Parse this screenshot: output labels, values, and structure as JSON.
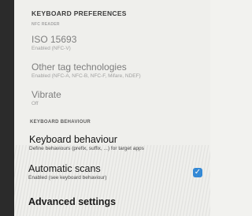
{
  "settings": {
    "keyboard_preferences_header": "KEYBOARD PREFERENCES",
    "nfc_reader_header": "NFC READER",
    "items": [
      {
        "title": "ISO 15693",
        "subtitle": "Enabled (NFC-V)"
      },
      {
        "title": "Other tag technologies",
        "subtitle": "Enabled (NFC-A, NFC-B, NFC-F, Mifare, NDEF)"
      },
      {
        "title": "Vibrate",
        "subtitle": "Off"
      }
    ],
    "keyboard_behaviour_header": "KEYBOARD BEHAVIOUR",
    "keyboard_behaviour": {
      "title": "Keyboard behaviour",
      "subtitle": "Define behaviours (prefix, suffix, ...) for target apps"
    },
    "automatic_scans": {
      "title": "Automatic scans",
      "subtitle": "Enabled (see keyboard behaviour)",
      "checked": true,
      "check_color": "#2f88d8"
    },
    "advanced_settings": {
      "title": "Advanced settings"
    }
  }
}
